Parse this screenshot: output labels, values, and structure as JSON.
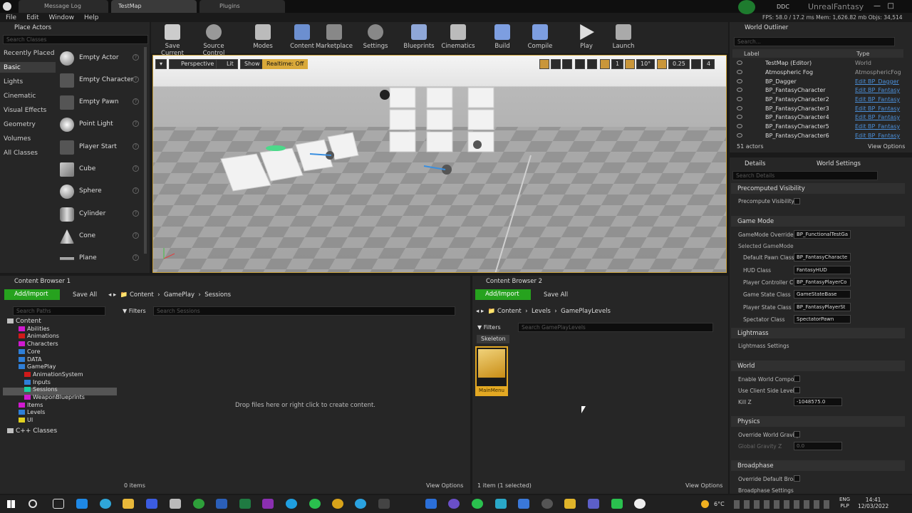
{
  "tabs": [
    {
      "label": "Message Log"
    },
    {
      "label": "TestMap"
    },
    {
      "label": "Plugins"
    }
  ],
  "top_right": {
    "ddc": "DDC",
    "project": "UnrealFantasy",
    "stats": "FPS: 58.0 / 17.2 ms  Mem: 1,626.82 mb  Objs: 34,514"
  },
  "menu": [
    "File",
    "Edit",
    "Window",
    "Help"
  ],
  "place_actors": {
    "title": "Place Actors",
    "search_placeholder": "Search Classes",
    "categories": [
      "Recently Placed",
      "Basic",
      "Lights",
      "Cinematic",
      "Visual Effects",
      "Geometry",
      "Volumes",
      "All Classes"
    ],
    "selected_category": "Basic",
    "items": [
      "Empty Actor",
      "Empty Character",
      "Empty Pawn",
      "Point Light",
      "Player Start",
      "Cube",
      "Sphere",
      "Cylinder",
      "Cone",
      "Plane"
    ]
  },
  "toolbar": [
    "Save Current",
    "Source Control",
    "Modes",
    "Content",
    "Marketplace",
    "Settings",
    "Blueprints",
    "Cinematics",
    "Build",
    "Compile",
    "Play",
    "Launch"
  ],
  "viewport": {
    "perspective": "Perspective",
    "lit": "Lit",
    "show": "Show",
    "realtime": "Realtime: Off",
    "snap_angle": "10°",
    "scale": "0.25",
    "cam_speed": "4",
    "grid": "1"
  },
  "world_outliner": {
    "title": "World Outliner",
    "search_placeholder": "Search...",
    "col_label": "Label",
    "col_type": "Type",
    "rows": [
      {
        "name": "TestMap (Editor)",
        "type": "World",
        "link": false
      },
      {
        "name": "Atmospheric Fog",
        "type": "AtmosphericFog",
        "link": false
      },
      {
        "name": "BP_Dagger",
        "type": "Edit BP_Dagger",
        "link": true
      },
      {
        "name": "BP_FantasyCharacter",
        "type": "Edit BP_Fantasy",
        "link": true
      },
      {
        "name": "BP_FantasyCharacter2",
        "type": "Edit BP_Fantasy",
        "link": true
      },
      {
        "name": "BP_FantasyCharacter3",
        "type": "Edit BP_Fantasy",
        "link": true
      },
      {
        "name": "BP_FantasyCharacter4",
        "type": "Edit BP_Fantasy",
        "link": true
      },
      {
        "name": "BP_FantasyCharacter5",
        "type": "Edit BP_Fantasy",
        "link": true
      },
      {
        "name": "BP_FantasyCharacter6",
        "type": "Edit BP_Fantasy",
        "link": true
      }
    ],
    "count": "51 actors",
    "view_options": "View Options"
  },
  "details": {
    "tab1": "Details",
    "tab2": "World Settings",
    "search_placeholder": "Search Details",
    "sections": {
      "precomputed": "Precomputed Visibility",
      "game_mode": "Game Mode",
      "selected_gm": "Selected GameMode",
      "lightmass": "Lightmass",
      "world": "World",
      "physics": "Physics",
      "broadphase": "Broadphase"
    },
    "props": {
      "precompute_vis": "Precompute Visibility",
      "gm_override": "GameMode Override",
      "gm_override_val": "BP_FunctionalTestGa",
      "default_pawn": "Default Pawn Class",
      "default_pawn_val": "BP_FantasyCharacte",
      "hud": "HUD Class",
      "hud_val": "FantasyHUD",
      "pc": "Player Controller Cl",
      "pc_val": "BP_FantasyPlayerCo",
      "gs": "Game State Class",
      "gs_val": "GameStateBase",
      "ps": "Player State Class",
      "ps_val": "BP_FantasyPlayerSt",
      "spec": "Spectator Class",
      "spec_val": "SpectatorPawn",
      "lightmass_settings": "Lightmass Settings",
      "enable_wc": "Enable World Composi",
      "use_client": "Use Client Side Level",
      "killz": "Kill Z",
      "killz_val": "-1048575.0",
      "override_grav": "Override World Gravity",
      "global_grav": "Global Gravity Z",
      "global_grav_val": "0.0",
      "override_broad": "Override Default Broa",
      "broad_settings": "Broadphase Settings"
    }
  },
  "cb1": {
    "title": "Content Browser 1",
    "add_import": "Add/Import",
    "save_all": "Save All",
    "path": [
      "Content",
      "GamePlay",
      "Sessions"
    ],
    "search_paths": "Search Paths",
    "filters": "Filters",
    "search_placeholder": "Search Sessions",
    "tree": [
      {
        "label": "Content",
        "depth": 0,
        "color": "#c0c0c0"
      },
      {
        "label": "Abilities",
        "depth": 1,
        "color": "#d01ad0"
      },
      {
        "label": "Animations",
        "depth": 1,
        "color": "#d01a1a"
      },
      {
        "label": "Characters",
        "depth": 1,
        "color": "#d01ad0"
      },
      {
        "label": "Core",
        "depth": 1,
        "color": "#2f7fd8"
      },
      {
        "label": "DATA",
        "depth": 1,
        "color": "#2f7fd8"
      },
      {
        "label": "GamePlay",
        "depth": 1,
        "color": "#2f7fd8"
      },
      {
        "label": "AnimationSystem",
        "depth": 2,
        "color": "#d01a1a"
      },
      {
        "label": "Inputs",
        "depth": 2,
        "color": "#2f7fd8"
      },
      {
        "label": "Sessions",
        "depth": 2,
        "color": "#1ad0a0"
      },
      {
        "label": "WeaponBlueprints",
        "depth": 2,
        "color": "#d01ad0"
      },
      {
        "label": "Items",
        "depth": 1,
        "color": "#d01ad0"
      },
      {
        "label": "Levels",
        "depth": 1,
        "color": "#2f7fd8"
      },
      {
        "label": "UI",
        "depth": 1,
        "color": "#e0d020"
      },
      {
        "label": "C++ Classes",
        "depth": 0,
        "color": "#c0c0c0"
      }
    ],
    "empty_msg": "Drop files here or right click to create content.",
    "count": "0 items",
    "view_options": "View Options"
  },
  "cb2": {
    "title": "Content Browser 2",
    "add_import": "Add/Import",
    "save_all": "Save All",
    "path": [
      "Content",
      "Levels",
      "GamePlayLevels"
    ],
    "filters": "Filters",
    "search_placeholder": "Search GamePlayLevels",
    "filter_chip": "Skeleton",
    "asset": "MainMenu",
    "count": "1 item (1 selected)",
    "view_options": "View Options"
  },
  "taskbar": {
    "temp": "6°C",
    "lang1": "ENG",
    "lang2": "PLP",
    "time": "14:41",
    "date": "12/03/2022"
  }
}
